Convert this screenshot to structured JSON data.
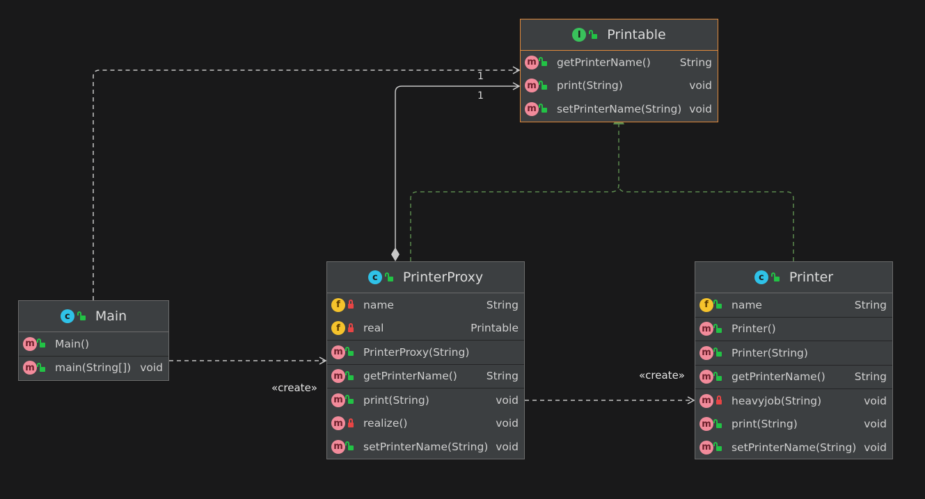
{
  "classes": {
    "printable": {
      "title": "Printable",
      "kind_icon": "I",
      "members": [
        {
          "icon": "m",
          "name": "getPrinterName()",
          "type": "String"
        },
        {
          "icon": "m",
          "name": "print(String)",
          "type": "void"
        },
        {
          "icon": "m",
          "name": "setPrinterName(String)",
          "type": "void"
        }
      ]
    },
    "main": {
      "title": "Main",
      "kind_icon": "c",
      "members": [
        {
          "icon": "m",
          "name": "Main()",
          "type": ""
        },
        {
          "icon": "m",
          "name": "main(String[])",
          "type": "void"
        }
      ]
    },
    "proxy": {
      "title": "PrinterProxy",
      "kind_icon": "c",
      "members": [
        {
          "icon": "f",
          "name": "name",
          "type": "String"
        },
        {
          "icon": "f",
          "name": "real",
          "type": "Printable"
        },
        {
          "icon": "m",
          "name": "PrinterProxy(String)",
          "type": ""
        },
        {
          "icon": "m",
          "name": "getPrinterName()",
          "type": "String"
        },
        {
          "icon": "m",
          "name": "print(String)",
          "type": "void"
        },
        {
          "icon": "m",
          "name": "realize()",
          "type": "void"
        },
        {
          "icon": "m",
          "name": "setPrinterName(String)",
          "type": "void"
        }
      ]
    },
    "printer": {
      "title": "Printer",
      "kind_icon": "c",
      "members": [
        {
          "icon": "f",
          "name": "name",
          "type": "String"
        },
        {
          "icon": "m",
          "name": "Printer()",
          "type": ""
        },
        {
          "icon": "m",
          "name": "Printer(String)",
          "type": ""
        },
        {
          "icon": "m",
          "name": "getPrinterName()",
          "type": "String"
        },
        {
          "icon": "m",
          "name": "heavyjob(String)",
          "type": "void"
        },
        {
          "icon": "m",
          "name": "print(String)",
          "type": "void"
        },
        {
          "icon": "m",
          "name": "setPrinterName(String)",
          "type": "void"
        }
      ]
    }
  },
  "labels": {
    "create_proxy": "«create»",
    "create_printer": "«create»",
    "mult_main": "1",
    "mult_proxy": "1"
  },
  "colors": {
    "realization": "#5c8a4e",
    "dependency": "#c8c8c8",
    "interface_border": "#e38b3c"
  }
}
